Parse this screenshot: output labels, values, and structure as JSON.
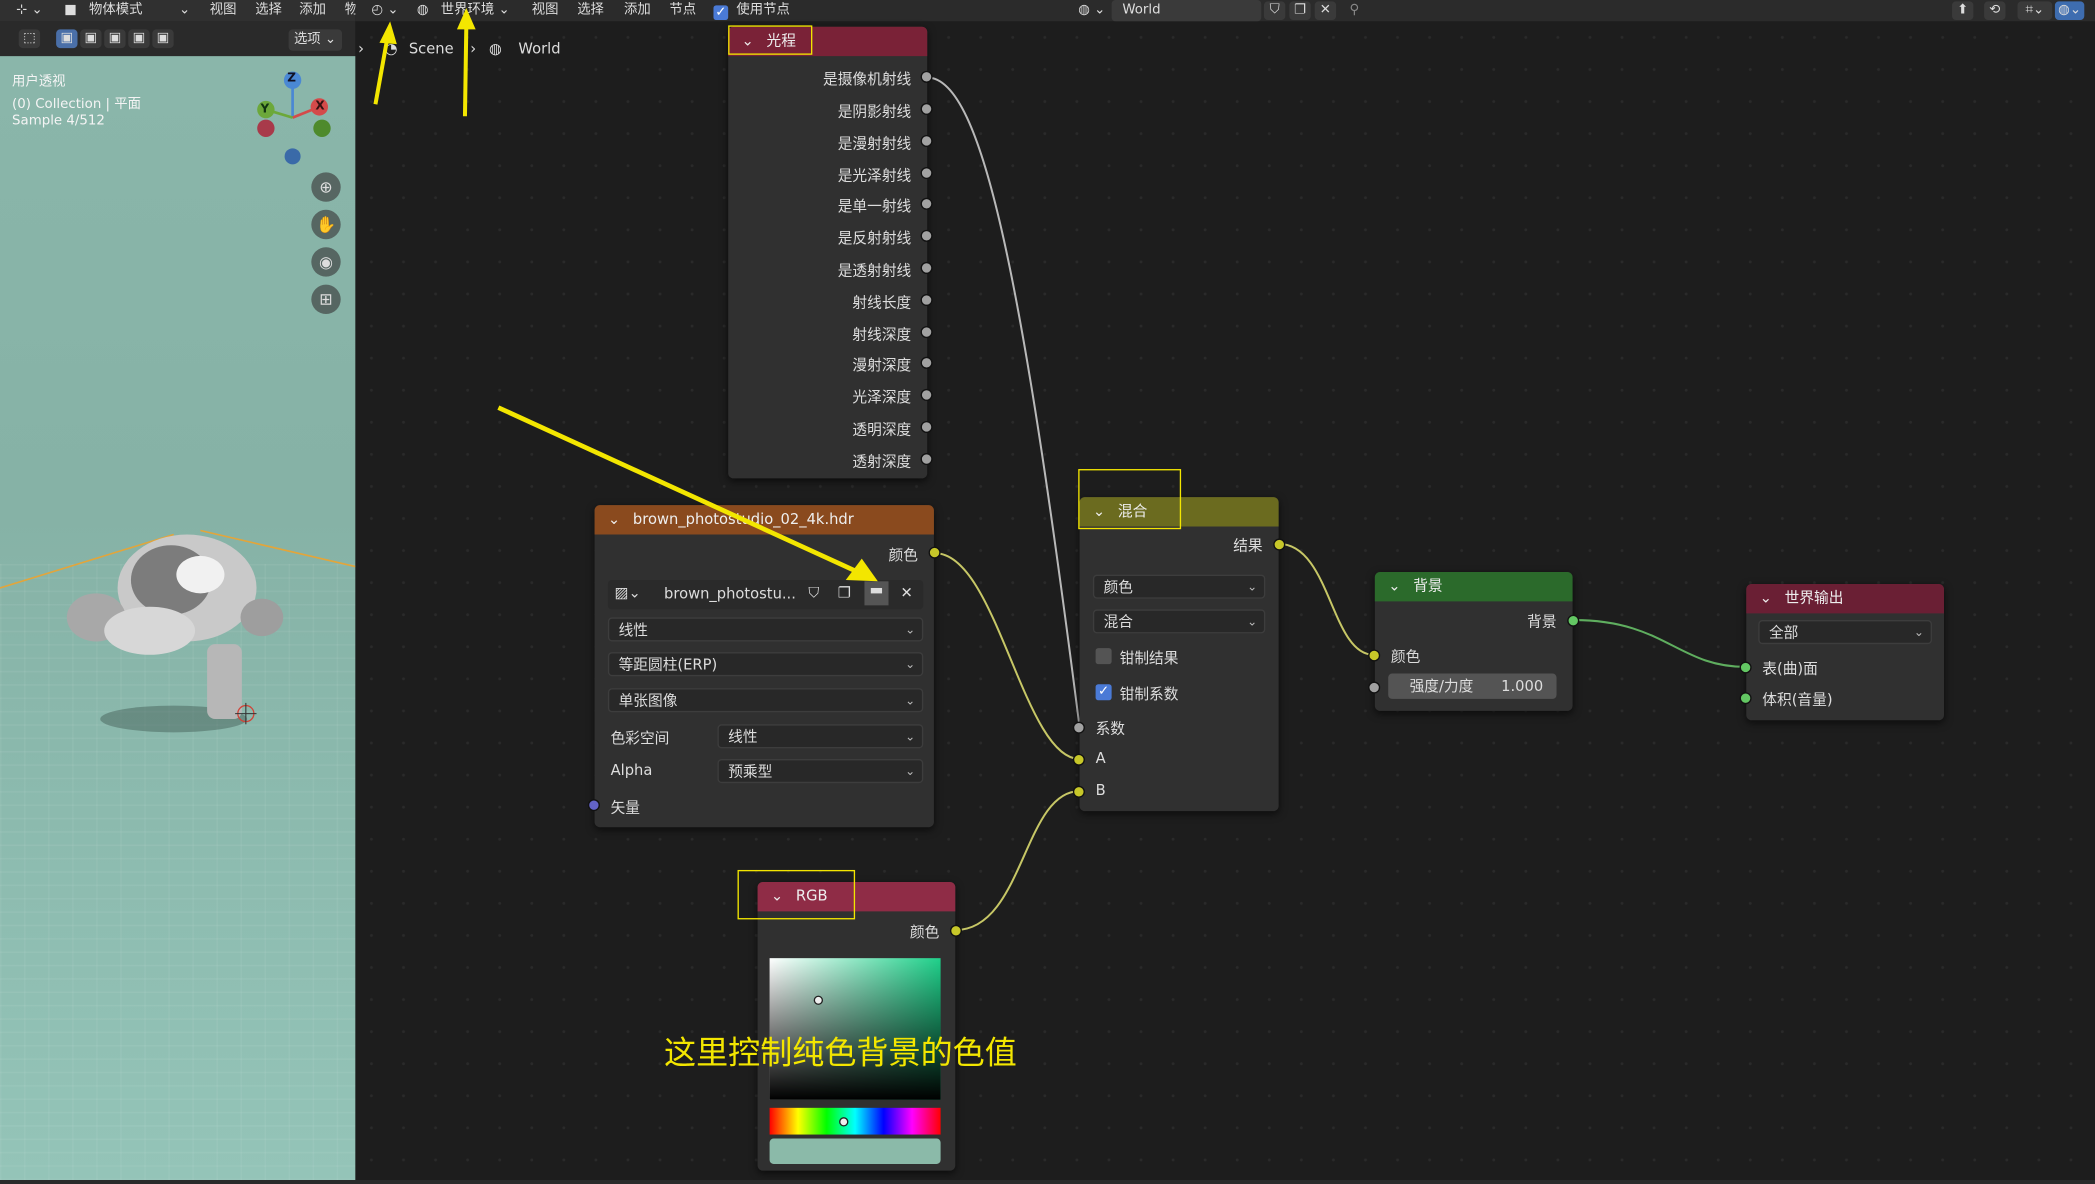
{
  "header_left": {
    "mode": "物体模式",
    "menus": [
      "视图",
      "选择",
      "添加",
      "物"
    ],
    "options_label": "选项"
  },
  "header_right": {
    "shader_type": "世界环境",
    "menus": [
      "视图",
      "选择",
      "添加",
      "节点"
    ],
    "use_nodes_label": "使用节点",
    "world_name": "World"
  },
  "breadcrumb": {
    "scene": "Scene",
    "world": "World"
  },
  "viewport": {
    "view_name": "用户透视",
    "collection": "(0) Collection | 平面",
    "sample": "Sample 4/512",
    "axes": {
      "x": "X",
      "y": "Y",
      "z": "Z"
    }
  },
  "nodes": {
    "light_path": {
      "title": "光程",
      "outputs": [
        "是摄像机射线",
        "是阴影射线",
        "是漫射射线",
        "是光泽射线",
        "是单一射线",
        "是反射射线",
        "是透射射线",
        "射线长度",
        "射线深度",
        "漫射深度",
        "光泽深度",
        "透明深度",
        "透射深度"
      ]
    },
    "env_texture": {
      "title": "brown_photostudio_02_4k.hdr",
      "output": "颜色",
      "image_name": "brown_photostu...",
      "interpolation": "线性",
      "projection": "等距圆柱(ERP)",
      "source": "单张图像",
      "colorspace_label": "色彩空间",
      "colorspace": "线性",
      "alpha_label": "Alpha",
      "alpha": "预乘型",
      "vector_label": "矢量"
    },
    "mix": {
      "title": "混合",
      "output": "结果",
      "data_type": "颜色",
      "blend_mode": "混合",
      "clamp_result": "钳制结果",
      "clamp_factor": "钳制系数",
      "inputs": [
        "系数",
        "A",
        "B"
      ]
    },
    "background": {
      "title": "背景",
      "output": "背景",
      "input_color": "颜色",
      "strength_label": "强度/力度",
      "strength": "1.000"
    },
    "world_output": {
      "title": "世界输出",
      "target": "全部",
      "inputs": [
        "表(曲)面",
        "体积(音量)"
      ]
    },
    "rgb": {
      "title": "RGB",
      "output": "颜色",
      "color": "#8bbaa9"
    }
  },
  "annotation": "这里控制纯色背景的色值",
  "colors": {
    "accent_yellow": "#f3e600",
    "light_path_header": "#7a2237",
    "texture_header": "#8a4a1e",
    "mix_header": "#6b6b1f",
    "background_header": "#2b6a2b",
    "output_header": "#6a1f34",
    "rgb_header": "#8f2c46",
    "link_yellow": "#c7c766",
    "link_green": "#5fae5f",
    "link_gray": "#b9b9b9"
  }
}
